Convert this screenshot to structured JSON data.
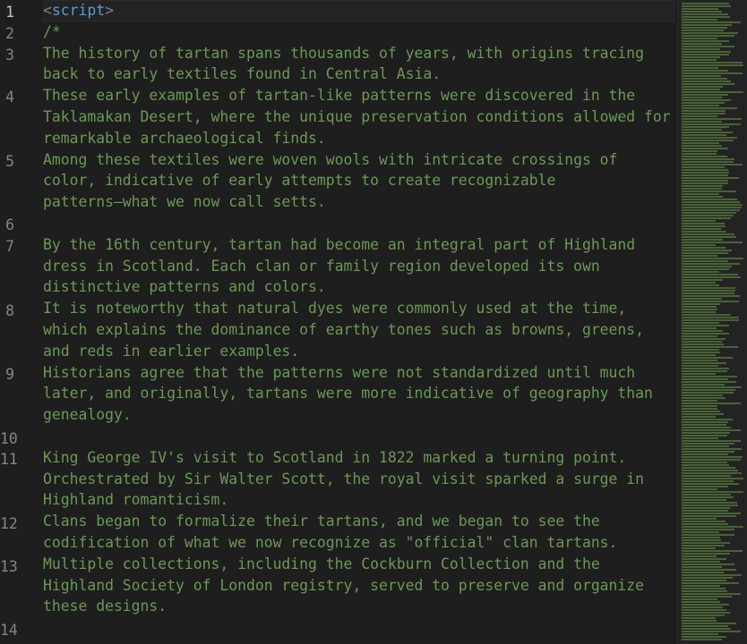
{
  "editor": {
    "line_numbers": [
      "1",
      "2",
      "3",
      "4",
      "5",
      "6",
      "7",
      "8",
      "9",
      "10",
      "11",
      "12",
      "13",
      "14"
    ],
    "code": {
      "l1_open": "<",
      "l1_tag": "script",
      "l1_close": ">",
      "l2": "/*",
      "l3a": "The history of tartan spans thousands of years, with origins tracing",
      "l3b": "back to early textiles found in Central Asia.",
      "l4a": "These early examples of tartan-like patterns were discovered in the",
      "l4b": "Taklamakan Desert, where the unique preservation conditions allowed for",
      "l4c": "remarkable archaeological finds.",
      "l5a": "Among these textiles were woven wools with intricate crossings of",
      "l5b": "color, indicative of early attempts to create recognizable",
      "l5c": "patterns—what we now call setts.",
      "l7a": "By the 16th century, tartan had become an integral part of Highland",
      "l7b": "dress in Scotland. Each clan or family region developed its own",
      "l7c": "distinctive patterns and colors.",
      "l8a": "It is noteworthy that natural dyes were commonly used at the time,",
      "l8b": "which explains the dominance of earthy tones such as browns, greens,",
      "l8c": "and reds in earlier examples.",
      "l9a": "Historians agree that the patterns were not standardized until much",
      "l9b": "later, and originally, tartans were more indicative of geography than",
      "l9c": "genealogy.",
      "l11a": "King George IV's visit to Scotland in 1822 marked a turning point.",
      "l11b": "Orchestrated by Sir Walter Scott, the royal visit sparked a surge in",
      "l11c": "Highland romanticism.",
      "l12a": "Clans began to formalize their tartans, and we began to see the",
      "l12b": "codification of what we now recognize as \"official\" clan tartans.",
      "l13a": "Multiple collections, including the Cockburn Collection and the",
      "l13b": "Highland Society of London registry, served to preserve and organize",
      "l13c": "these designs."
    }
  },
  "colors": {
    "background": "#1e1e1e",
    "comment": "#6a9955",
    "tag": "#569cd6",
    "bracket": "#808080",
    "line_number": "#858585"
  }
}
